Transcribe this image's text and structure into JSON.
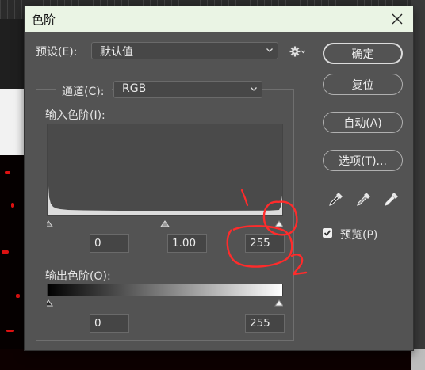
{
  "dialog": {
    "title": "色阶",
    "preset": {
      "label": "预设(E):",
      "value": "默认值"
    },
    "channel": {
      "label": "通道(C):",
      "value": "RGB"
    },
    "input_levels": {
      "label": "输入色阶(I):",
      "shadow": "0",
      "midtone": "1.00",
      "highlight": "255"
    },
    "output_levels": {
      "label": "输出色阶(O):",
      "shadow": "0",
      "highlight": "255"
    },
    "buttons": {
      "ok": "确定",
      "reset": "复位",
      "auto": "自动(A)",
      "options": "选项(T)..."
    },
    "preview": {
      "label": "预览(P)",
      "checked": true
    }
  },
  "annotations": {
    "mark_1": "1",
    "mark_2": "2",
    "color": "#ff2b2b"
  },
  "icons": [
    "close-icon",
    "gear-icon",
    "chevron-down-icon",
    "shadow-eyedropper-icon",
    "midtone-eyedropper-icon",
    "highlight-eyedropper-icon",
    "checkmark-icon"
  ]
}
